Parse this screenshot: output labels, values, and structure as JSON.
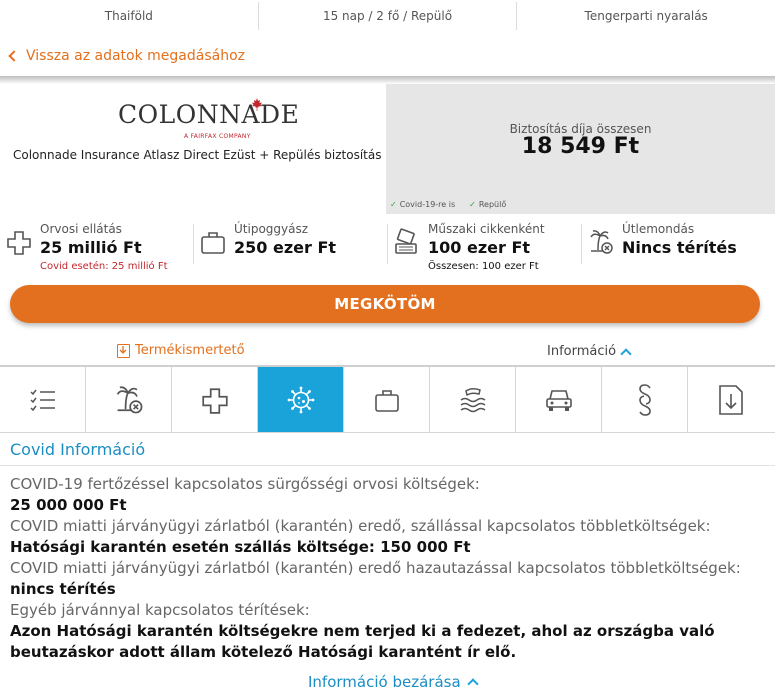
{
  "topbar": {
    "destination": "Thaiföld",
    "trip": "15 nap / 2 fő / Repülő",
    "type": "Tengerparti nyaralás"
  },
  "back_link": "Vissza az adatok megadásához",
  "offer": {
    "logo_text": "COLONNADE",
    "logo_sub": "A FAIRFAX COMPANY",
    "product_name": "Colonnade Insurance Atlasz Direct Ezüst + Repülés biztosítás",
    "price_label": "Biztosítás díja összesen",
    "price_value": "18 549 Ft",
    "badges": [
      "Covid-19-re is",
      "Repülő"
    ]
  },
  "features": [
    {
      "label": "Orvosi ellátás",
      "value": "25 millió Ft",
      "note": "Covid esetén: 25 millió Ft",
      "icon": "medical-cross-icon"
    },
    {
      "label": "Útipoggyász",
      "value": "250 ezer Ft",
      "note": "",
      "icon": "suitcase-icon"
    },
    {
      "label": "Műszaki cikkenként",
      "value": "100 ezer Ft",
      "note": "Összesen: 100 ezer Ft",
      "icon": "electronics-icon"
    },
    {
      "label": "Útlemondás",
      "value": "Nincs térítés",
      "note": "",
      "icon": "cancelled-trip-icon"
    }
  ],
  "cta_label": "MEGKÖTÖM",
  "doc_link": "Termékismertető",
  "info_link": "Információ",
  "tabs": [
    {
      "icon": "checklist-icon"
    },
    {
      "icon": "cancelled-trip-icon"
    },
    {
      "icon": "medical-cross-icon"
    },
    {
      "icon": "virus-icon",
      "active": true
    },
    {
      "icon": "suitcase-icon"
    },
    {
      "icon": "water-sports-icon"
    },
    {
      "icon": "car-icon"
    },
    {
      "icon": "paragraph-icon"
    },
    {
      "icon": "download-document-icon"
    }
  ],
  "section_title": "Covid Információ",
  "info": [
    {
      "q": "COVID-19 fertőzéssel kapcsolatos sürgősségi orvosi költségek:",
      "a": "25 000 000 Ft"
    },
    {
      "q": "COVID miatti járványügyi zárlatból (karantén) eredő, szállással kapcsolatos többletköltségek:",
      "a": "Hatósági karantén esetén szállás költsége: 150 000 Ft"
    },
    {
      "q": "COVID miatti járványügyi zárlatból (karantén) eredő hazautazással kapcsolatos többletköltségek:",
      "a": "nincs térítés"
    },
    {
      "q": "Egyéb járvánnyal kapcsolatos térítések:",
      "a": "Azon Hatósági karantén költségekre nem terjed ki a fedezet, ahol az országba való beutazáskor adott állam kötelező Hatósági karantént ír elő."
    }
  ],
  "close_link": "Információ bezárása",
  "colors": {
    "accent": "#e2701e",
    "blue": "#1aa3d9",
    "alert_red": "#c1272d"
  }
}
